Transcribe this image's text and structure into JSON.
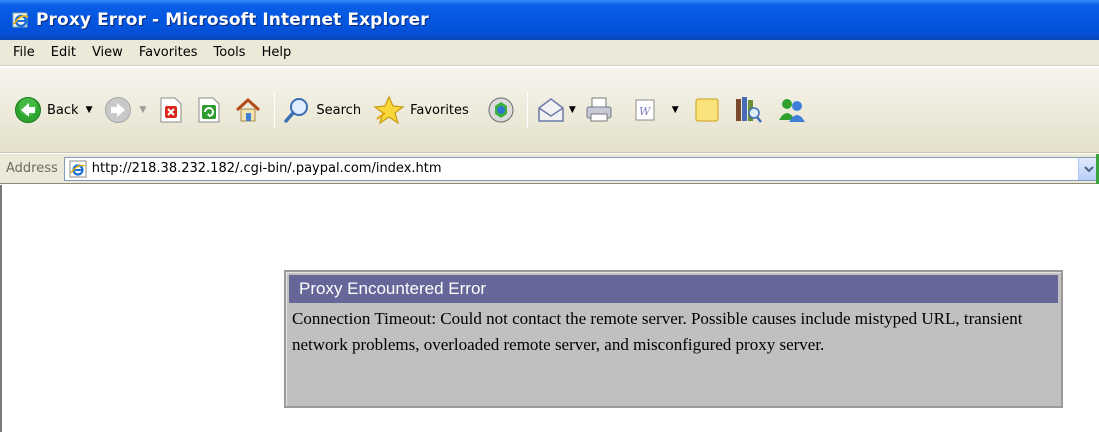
{
  "window": {
    "title": "Proxy Error - Microsoft Internet Explorer"
  },
  "menu": [
    "File",
    "Edit",
    "View",
    "Favorites",
    "Tools",
    "Help"
  ],
  "toolbar": {
    "back_label": "Back",
    "search_label": "Search",
    "favorites_label": "Favorites"
  },
  "address": {
    "label": "Address",
    "url": "http://218.38.232.182/.cgi-bin/.paypal.com/index.htm"
  },
  "error": {
    "title": "Proxy Encountered Error",
    "message": "Connection Timeout: Could not contact the remote server. Possible causes include mistyped URL, transient network problems, overloaded remote server, and misconfigured proxy server."
  },
  "colors": {
    "error_header_bg": "#666699",
    "error_box_bg": "#c0c0c0",
    "titlebar_blue": "#0556e0"
  }
}
